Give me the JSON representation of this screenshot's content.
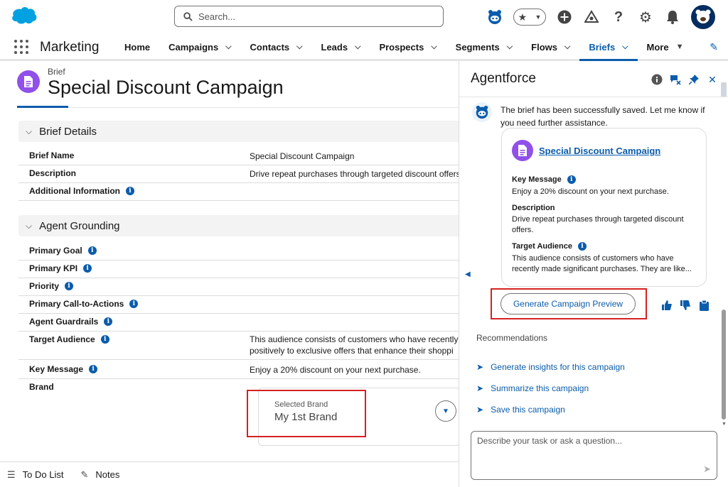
{
  "colors": {
    "brand": "#0b5cab",
    "brief_icon": "#9050e9",
    "highlight": "#d62121"
  },
  "header": {
    "search_placeholder": "Search...",
    "icons": [
      "salesforce-logo",
      "search-icon",
      "agent-icon",
      "favorites-icon",
      "add-icon",
      "setup-assistant-icon",
      "help-icon",
      "gear-icon",
      "bell-icon",
      "avatar"
    ]
  },
  "nav": {
    "app_name": "Marketing",
    "items": [
      {
        "label": "Home",
        "dropdown": false
      },
      {
        "label": "Campaigns",
        "dropdown": true
      },
      {
        "label": "Contacts",
        "dropdown": true
      },
      {
        "label": "Leads",
        "dropdown": true
      },
      {
        "label": "Prospects",
        "dropdown": true
      },
      {
        "label": "Segments",
        "dropdown": true
      },
      {
        "label": "Flows",
        "dropdown": true
      },
      {
        "label": "Briefs",
        "dropdown": true,
        "active": true
      },
      {
        "label": "More",
        "dropdown": true
      }
    ]
  },
  "record": {
    "type": "Brief",
    "title": "Special Discount Campaign",
    "sections": {
      "details": "Brief Details",
      "grounding": "Agent Grounding"
    },
    "details": {
      "brief_name_label": "Brief Name",
      "brief_name_value": "Special Discount Campaign",
      "description_label": "Description",
      "description_value": "Drive repeat purchases through targeted discount offers.",
      "additional_label": "Additional Information"
    },
    "grounding": {
      "primary_goal": "Primary Goal",
      "primary_kpi": "Primary KPI",
      "priority": "Priority",
      "cta": "Primary Call-to-Actions",
      "guardrails": "Agent Guardrails",
      "audience_label": "Target Audience",
      "audience_value_1": "This audience consists of customers who have recently",
      "audience_value_2": "positively to exclusive offers that enhance their shoppi",
      "key_message_label": "Key Message",
      "key_message_value": "Enjoy a 20% discount on your next purchase.",
      "brand_label": "Brand",
      "brand_sub": "Selected Brand",
      "brand_value": "My 1st Brand"
    }
  },
  "utility": {
    "todo": "To Do List",
    "notes": "Notes"
  },
  "agent": {
    "title": "Agentforce",
    "message": "The brief has been successfully saved. Let me know if you need further assistance.",
    "card": {
      "link": "Special Discount Campaign",
      "key_message_label": "Key Message",
      "key_message_value": "Enjoy a 20% discount on your next purchase.",
      "description_label": "Description",
      "description_value": "Drive repeat purchases through targeted discount offers.",
      "audience_label": "Target Audience",
      "audience_value": "This audience consists of customers who have recently made significant purchases. They are like..."
    },
    "generate_button": "Generate Campaign Preview",
    "recommendations_title": "Recommendations",
    "recommendations": [
      "Generate insights for this campaign",
      "Summarize this campaign",
      "Save this campaign"
    ],
    "composer_placeholder": "Describe your task or ask a question..."
  }
}
